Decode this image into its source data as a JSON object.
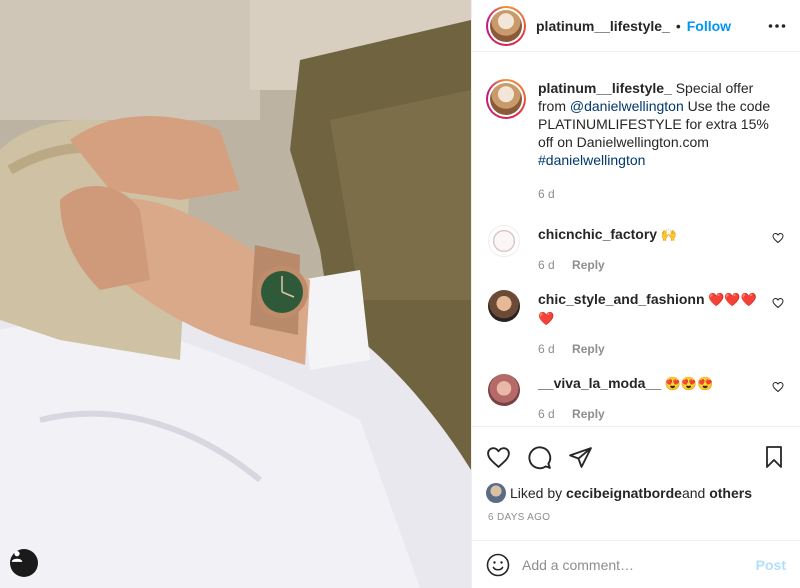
{
  "photo": {
    "alt_icon": "user-tag-icon"
  },
  "header": {
    "username": "platinum__lifestyle_",
    "separator": "•",
    "follow_label": "Follow",
    "more_icon": "more-options-icon"
  },
  "caption": {
    "username": "platinum__lifestyle_",
    "text_1": " Special offer from ",
    "mention": "@danielwellington",
    "text_2": " Use the code PLATINUMLIFESTYLE for extra 15% off on Danielwellington.com ",
    "hashtag": "#danielwellington",
    "time": "6 d"
  },
  "comments": [
    {
      "username": "chicnchic_factory",
      "text": " 🙌",
      "time": "6 d",
      "reply": "Reply"
    },
    {
      "username": "chic_style_and_fashionn",
      "text": " ❤️❤️❤️❤️",
      "time": "6 d",
      "reply": "Reply"
    },
    {
      "username": "__viva_la_moda__",
      "text": " 😍😍😍",
      "time": "6 d",
      "reply": "Reply"
    }
  ],
  "actions": {
    "like_icon": "heart-icon",
    "comment_icon": "comment-icon",
    "share_icon": "share-icon",
    "save_icon": "bookmark-icon"
  },
  "likes": {
    "prefix": "Liked by ",
    "user": "cecibeignatborde",
    "middle": " and ",
    "others": "others"
  },
  "date": "6 DAYS AGO",
  "add_comment": {
    "placeholder": "Add a comment…",
    "post_label": "Post"
  },
  "colors": {
    "accent": "#0095f6",
    "mention": "#00376b",
    "muted": "#8e8e8e",
    "post_disabled": "#b2dffc"
  }
}
